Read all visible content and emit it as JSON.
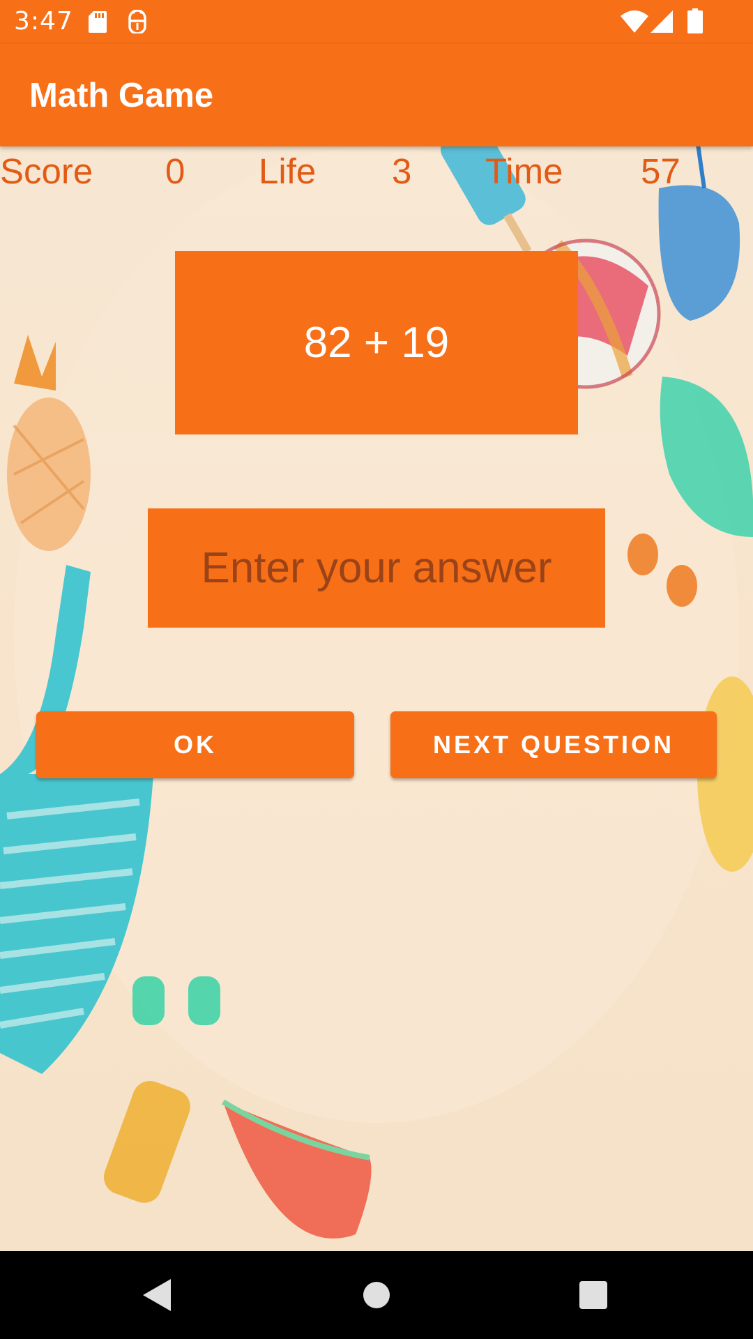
{
  "status_bar": {
    "time": "3:47",
    "icons": [
      "sd-card-icon",
      "debug-icon",
      "wifi-icon",
      "cell-signal-icon",
      "battery-icon"
    ]
  },
  "app_bar": {
    "title": "Math Game"
  },
  "stats": {
    "score_label": "Score",
    "score_value": "0",
    "life_label": "Life",
    "life_value": "3",
    "time_label": "Time",
    "time_value": "57"
  },
  "question": {
    "text": "82 + 19"
  },
  "answer_input": {
    "value": "",
    "placeholder": "Enter your answer"
  },
  "buttons": {
    "ok_label": "OK",
    "next_label": "NEXT QUESTION"
  },
  "nav_bar": {
    "icons": [
      "back-icon",
      "home-icon",
      "recents-icon"
    ]
  },
  "colors": {
    "accent": "#f76f17",
    "stat_text": "#e35a14",
    "placeholder_text": "#9a4318",
    "background": "#f8e6cf",
    "nav_bar": "#000000"
  }
}
